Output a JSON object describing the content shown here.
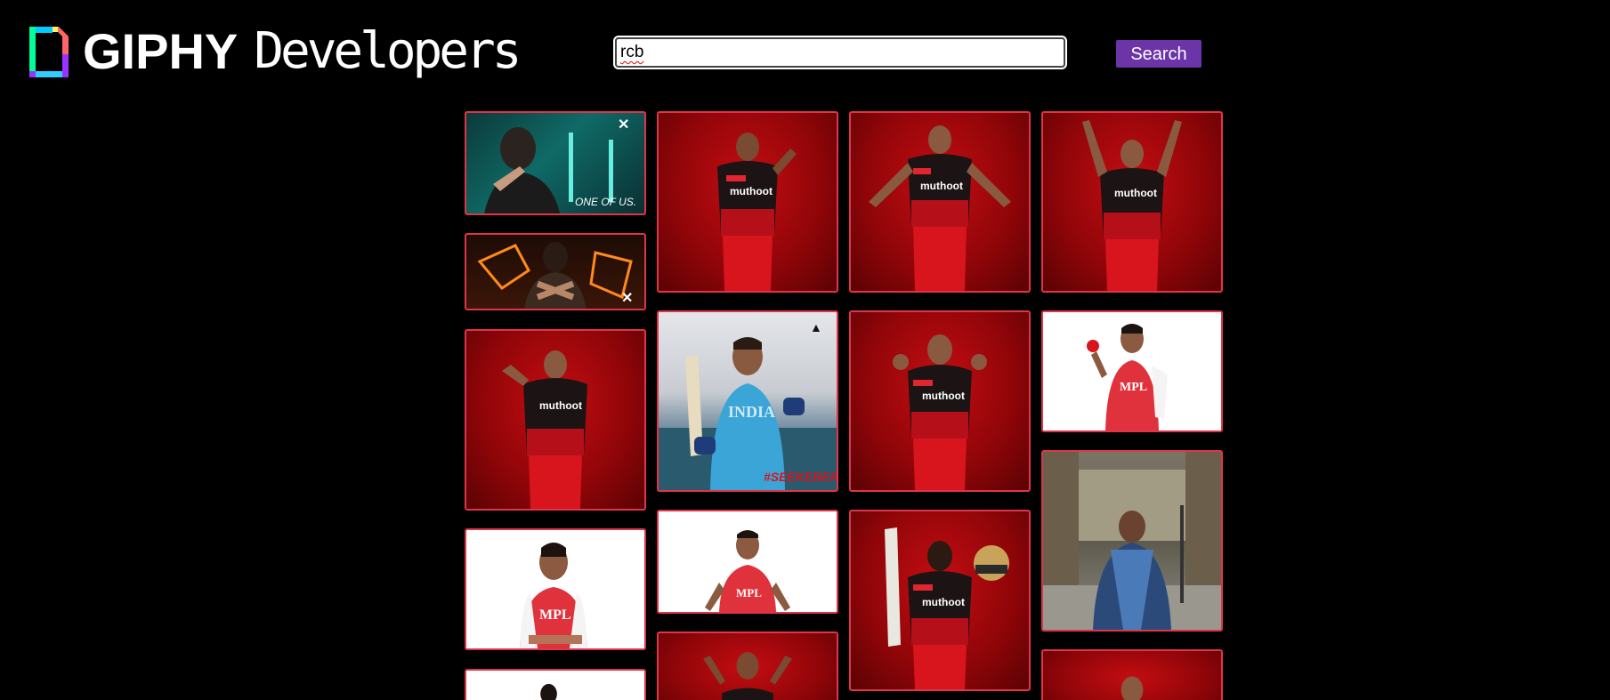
{
  "header": {
    "logo_word": "GIPHY",
    "logo_sub": "Developers",
    "search": {
      "value": "rcb"
    },
    "search_button_label": "Search"
  },
  "gifs": [
    {
      "name": "gif-virat-teal-neon",
      "icon": "brand-logo-icon",
      "caption": "ONE OF US."
    },
    {
      "name": "gif-virat-orange-neon",
      "icon": "brand-logo-icon"
    },
    {
      "name": "gif-player-red-1"
    },
    {
      "name": "gif-player-red-2"
    },
    {
      "name": "gif-player-red-3"
    },
    {
      "name": "gif-player-red-4"
    },
    {
      "name": "gif-virat-india-bat",
      "icon": "puma-icon"
    },
    {
      "name": "gif-player-red-5"
    },
    {
      "name": "gif-virat-mpl-ball"
    },
    {
      "name": "gif-virat-mpl-thinking"
    },
    {
      "name": "gif-virat-mpl-cheer"
    },
    {
      "name": "gif-player-red-helmet"
    },
    {
      "name": "gif-virat-street"
    },
    {
      "name": "gif-partial-white"
    },
    {
      "name": "gif-partial-red-1"
    },
    {
      "name": "gif-partial-red-2"
    }
  ],
  "colors": {
    "tile_border": "#e0344a",
    "search_button": "#6b35a8",
    "background": "#000000"
  }
}
